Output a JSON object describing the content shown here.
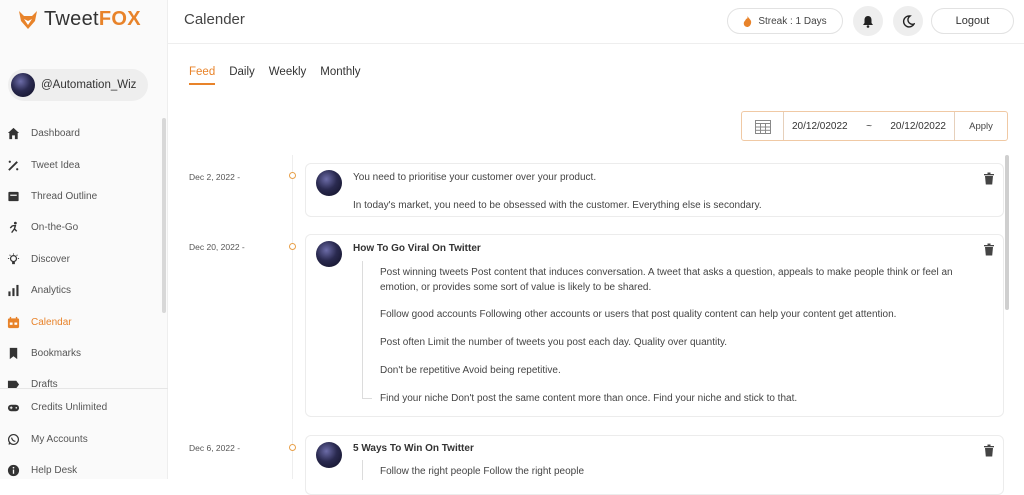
{
  "app": {
    "brand_plain": "Tweet",
    "brand_bold": "FOX"
  },
  "user": {
    "handle": "@Automation_Wiz"
  },
  "sidebar": {
    "items": [
      {
        "label": "Dashboard",
        "icon": "home-icon"
      },
      {
        "label": "Tweet Idea",
        "icon": "wand-icon"
      },
      {
        "label": "Thread Outline",
        "icon": "thread-icon"
      },
      {
        "label": "On-the-Go",
        "icon": "runner-icon"
      },
      {
        "label": "Discover",
        "icon": "bulb-icon"
      },
      {
        "label": "Analytics",
        "icon": "bar-chart-icon"
      },
      {
        "label": "Calendar",
        "icon": "calendar-icon",
        "active": true
      },
      {
        "label": "Bookmarks",
        "icon": "bookmark-icon"
      },
      {
        "label": "Drafts",
        "icon": "drafts-icon"
      }
    ],
    "bottom": [
      {
        "label": "Credits Unlimited",
        "icon": "gamepad-icon"
      },
      {
        "label": "My Accounts",
        "icon": "whatsapp-icon"
      },
      {
        "label": "Help Desk",
        "icon": "info-icon"
      }
    ]
  },
  "header": {
    "title": "Calender",
    "streak": "Streak : 1 Days",
    "logout": "Logout"
  },
  "tabs": [
    {
      "label": "Feed",
      "active": true
    },
    {
      "label": "Daily"
    },
    {
      "label": "Weekly"
    },
    {
      "label": "Monthly"
    }
  ],
  "date_filter": {
    "from": "20/12/02022",
    "separator": "~",
    "to": "20/12/02022",
    "apply": "Apply"
  },
  "feed": [
    {
      "date": "Dec 2, 2022 -",
      "lines": [
        "You need to prioritise your customer over your product.",
        "In today's market, you need to be obsessed with the customer. Everything else is secondary."
      ]
    },
    {
      "date": "Dec 20, 2022 -",
      "title": "How To Go Viral On Twitter",
      "points": [
        "Post winning tweets Post content that induces conversation. A tweet that asks a question, appeals to make people think or feel an emotion, or provides some sort of value is likely to be shared.",
        "Follow good accounts Following other accounts or users that post quality content can help your content get attention.",
        "Post often Limit the number of tweets you post each day. Quality over quantity.",
        "Don't be repetitive Avoid being repetitive.",
        "Find your niche Don't post the same content more than once. Find your niche and stick to that."
      ]
    },
    {
      "date": "Dec 6, 2022 -",
      "title": "5 Ways To Win On Twitter",
      "points": [
        "Follow the right people Follow the right people"
      ]
    }
  ],
  "colors": {
    "accent": "#e8832a"
  }
}
